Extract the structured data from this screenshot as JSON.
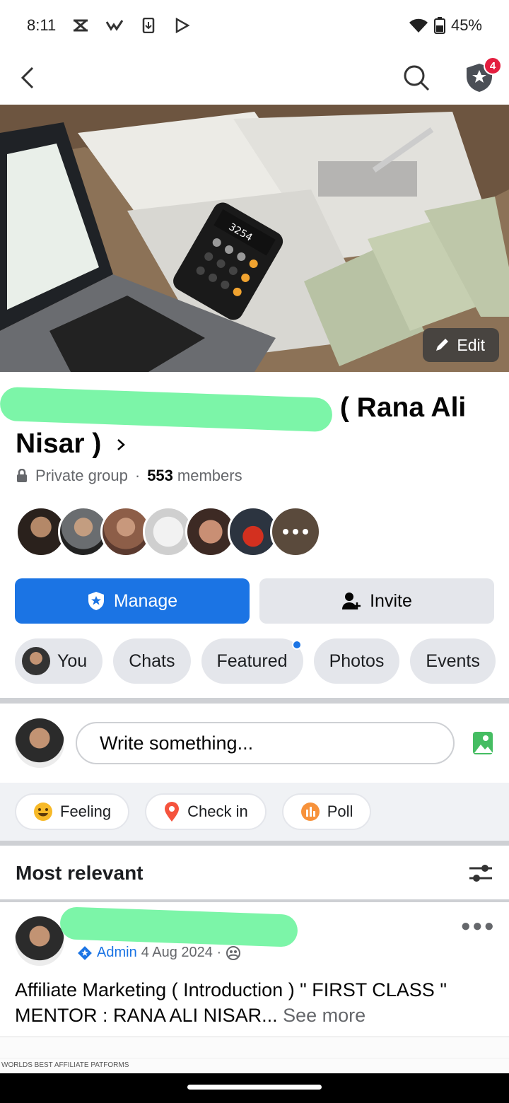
{
  "status": {
    "time": "8:11",
    "battery": "45%"
  },
  "header": {
    "notification_count": "4"
  },
  "cover": {
    "edit_label": "Edit"
  },
  "group": {
    "name_tail": "( Rana Ali",
    "name_line2": "Nisar )",
    "privacy": "Private group",
    "separator": "·",
    "member_count": "553",
    "members_label": "members"
  },
  "buttons": {
    "manage": "Manage",
    "invite": "Invite"
  },
  "tabs": [
    {
      "label": "You"
    },
    {
      "label": "Chats"
    },
    {
      "label": "Featured"
    },
    {
      "label": "Photos"
    },
    {
      "label": "Events"
    }
  ],
  "composer": {
    "placeholder": "Write something..."
  },
  "actions": {
    "feeling": "Feeling",
    "checkin": "Check in",
    "poll": "Poll"
  },
  "feed": {
    "sort_label": "Most relevant"
  },
  "post": {
    "role": "Admin",
    "date": "4 Aug 2024 ·",
    "text": "Affiliate Marketing ( Introduction ) \" FIRST CLASS \" MENTOR : RANA ALI NISAR...",
    "see_more": "See more",
    "image_caption": "WORLDS BEST AFFILIATE PATFORMS"
  }
}
